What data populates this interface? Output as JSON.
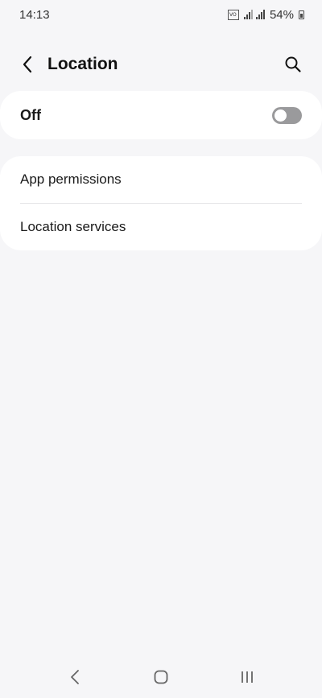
{
  "status_bar": {
    "time": "14:13",
    "battery": "54%",
    "volte_label": "VoLTE"
  },
  "header": {
    "title": "Location",
    "back_icon": "chevron-left-icon",
    "search_icon": "search-icon"
  },
  "master_switch": {
    "label": "Off",
    "state": false,
    "track_color": "#9a9a9c"
  },
  "settings": {
    "items": [
      {
        "label": "App permissions"
      },
      {
        "label": "Location services"
      }
    ]
  },
  "nav_bar": {
    "icons": [
      "back-icon",
      "home-icon",
      "recents-icon"
    ]
  }
}
